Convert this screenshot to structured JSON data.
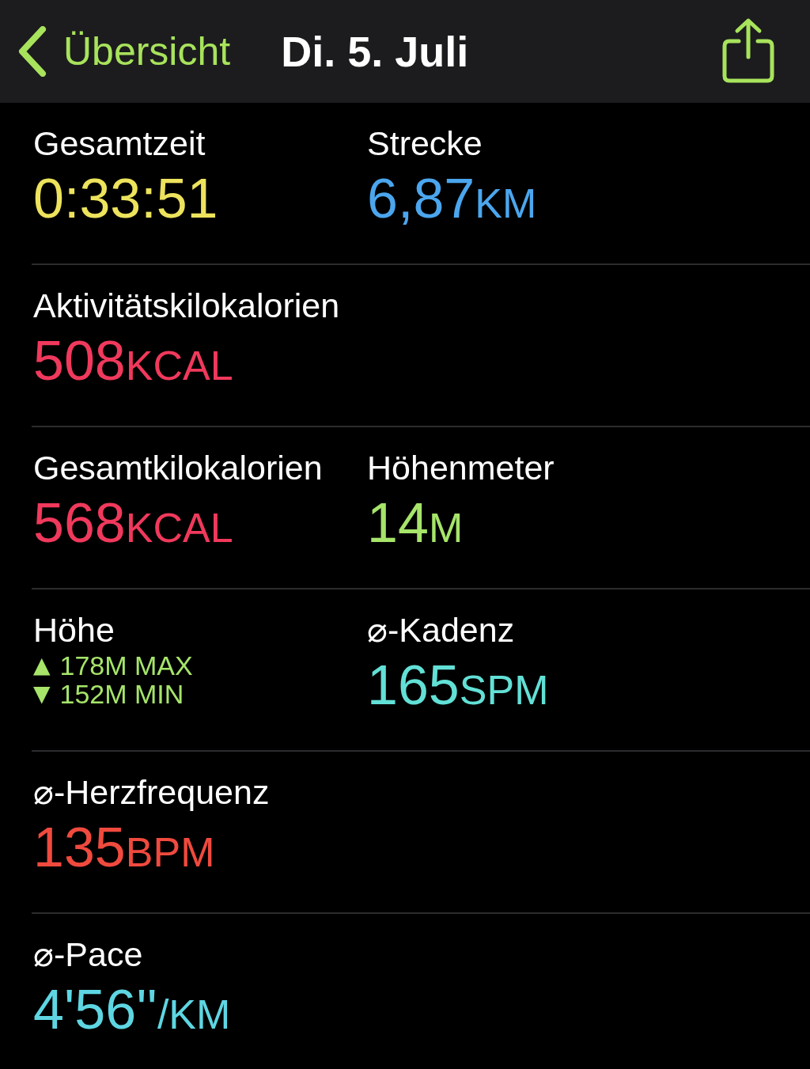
{
  "nav": {
    "back_label": "Übersicht",
    "title": "Di. 5. Juli"
  },
  "rows": [
    {
      "cells": [
        {
          "kind": "value",
          "label": "Gesamtzeit",
          "value": "0:33:51",
          "color": "#ede35c"
        },
        {
          "kind": "value",
          "label": "Strecke",
          "value": "6,87",
          "unit": "KM",
          "color": "#4ba6ee"
        }
      ]
    },
    {
      "cells": [
        {
          "kind": "value",
          "label": "Aktivitätskilokalorien",
          "value": "508",
          "unit": "KCAL",
          "color": "#f0395c"
        }
      ]
    },
    {
      "cells": [
        {
          "kind": "value",
          "label": "Gesamtkilokalorien",
          "value": "568",
          "unit": "KCAL",
          "color": "#f0395c"
        },
        {
          "kind": "value",
          "label": "Höhenmeter",
          "value": "14",
          "unit": "M",
          "color": "#a6e46a"
        }
      ]
    },
    {
      "cells": [
        {
          "kind": "range",
          "label": "Höhe",
          "lines": [
            {
              "icon": "▲",
              "text": "178M MAX"
            },
            {
              "icon": "▼",
              "text": "152M MIN"
            }
          ],
          "color": "#a6e46a"
        },
        {
          "kind": "value",
          "label": "⌀-Kadenz",
          "value": "165",
          "unit": "SPM",
          "color": "#62e0d6"
        }
      ]
    },
    {
      "cells": [
        {
          "kind": "value",
          "label": "⌀-Herzfrequenz",
          "value": "135",
          "unit": "BPM",
          "color": "#f04a3e"
        }
      ]
    },
    {
      "cells": [
        {
          "kind": "value",
          "label": "⌀-Pace",
          "value": "4'56''",
          "unit": "/KM",
          "color": "#5ed6e2"
        }
      ]
    }
  ]
}
